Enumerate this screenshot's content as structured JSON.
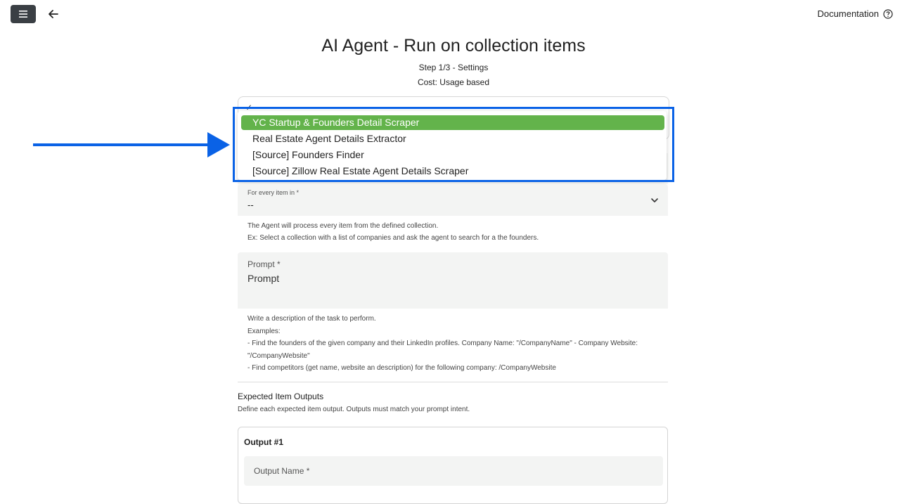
{
  "header": {
    "menu_icon": "hamburger-menu-icon",
    "back_icon": "arrow-left-icon",
    "documentation_label": "Documentation",
    "help_icon": "help-circle-icon"
  },
  "page": {
    "title": "AI Agent - Run on collection items",
    "step": "Step 1/3 - Settings",
    "cost": "Cost: Usage based"
  },
  "agent_select": {
    "check_glyph": "✓",
    "options": [
      "YC Startup & Founders Detail Scraper",
      "Real Estate Agent Details Extractor",
      "[Source] Founders Finder",
      "[Source] Zillow Real Estate Agent Details Scraper"
    ],
    "highlighted_index": 0,
    "highlight_color": "#63b34b"
  },
  "annotation": {
    "color": "#0a62e6"
  },
  "collection_field": {
    "label": "For every item in *",
    "value": "--",
    "help_line1": "The Agent will process every item from the defined collection.",
    "help_line2": "Ex: Select a collection with a list of companies and ask the agent to search for a the founders."
  },
  "prompt_field": {
    "label": "Prompt *",
    "placeholder": "Prompt",
    "help_lines": [
      "Write a description of the task to perform.",
      "Examples:",
      "- Find the founders of the given company and their LinkedIn profiles. Company Name: \"/CompanyName\" - Company Website: \"/CompanyWebsite\"",
      "- Find competitors (get name, website an description) for the following company: /CompanyWebsite"
    ]
  },
  "outputs": {
    "title": "Expected Item Outputs",
    "description": "Define each expected item output. Outputs must match your prompt intent.",
    "card_title": "Output #1",
    "name_label": "Output Name *"
  }
}
